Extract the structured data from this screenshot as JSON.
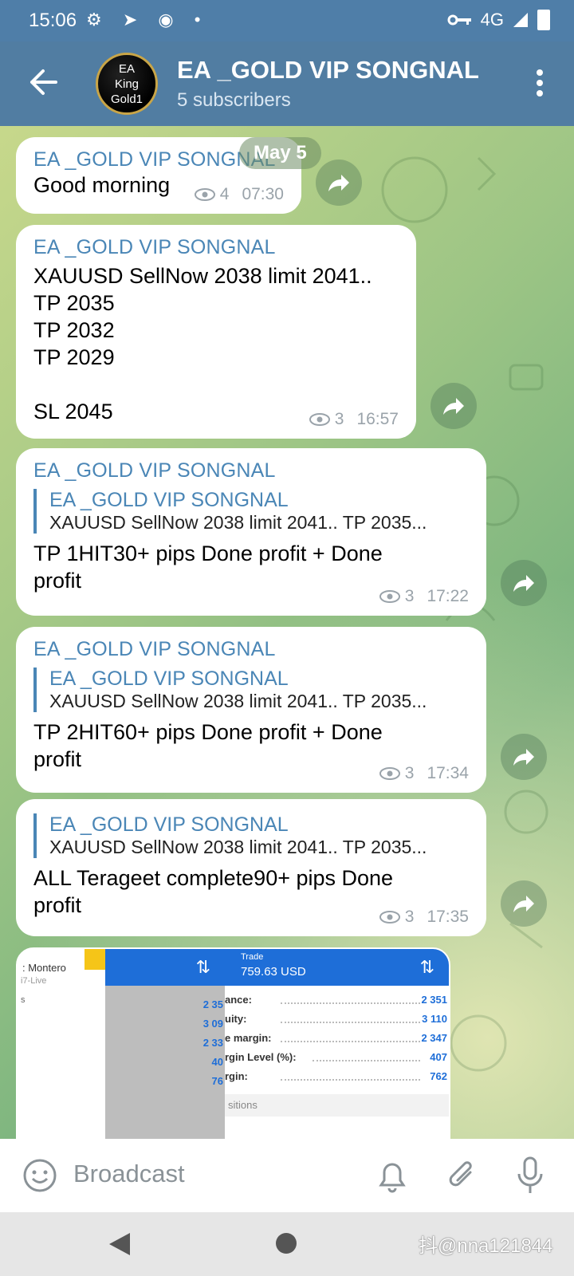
{
  "status": {
    "time": "15:06",
    "left_icons": "⚙ ➤ ◉ •",
    "network": "4G"
  },
  "header": {
    "title": "EA _GOLD VIP SONGNAL",
    "subtitle": "5 subscribers",
    "avatar_text": "EA\nKing\nGold1"
  },
  "date_label": "May 5",
  "messages": [
    {
      "sender": "EA _GOLD VIP SONGNAL",
      "text": "Good morning",
      "views": "4",
      "time": "07:30"
    },
    {
      "sender": "EA _GOLD VIP SONGNAL",
      "text": "XAUUSD SellNow 2038 limit 2041..\nTP 2035\nTP 2032\nTP 2029\n\nSL 2045",
      "views": "3",
      "time": "16:57"
    },
    {
      "sender": "EA _GOLD VIP SONGNAL",
      "reply_name": "EA _GOLD VIP SONGNAL",
      "reply_text": "XAUUSD SellNow 2038 limit 2041.. TP 2035...",
      "text": "TP 1HIT30+ pips  Done profit + Done\nprofit",
      "views": "3",
      "time": "17:22"
    },
    {
      "sender": "EA _GOLD VIP SONGNAL",
      "reply_name": "EA _GOLD VIP SONGNAL",
      "reply_text": "XAUUSD SellNow 2038 limit 2041.. TP 2035...",
      "text": "TP 2HIT60+ pips  Done profit + Done\nprofit",
      "views": "3",
      "time": "17:34"
    },
    {
      "reply_name": "EA _GOLD VIP SONGNAL",
      "reply_text": "XAUUSD SellNow 2038 limit 2041.. TP 2035...",
      "text": "ALL Terageet complete90+ pips  Done\nprofit",
      "views": "3",
      "time": "17:35"
    }
  ],
  "photo": {
    "left_name": ": Montero",
    "left_sub": "i7-Live",
    "left_s": "s",
    "mid_numbers": [
      "2 35",
      "3 09",
      "2 33",
      "40",
      "76"
    ],
    "right_header_label": "Trade",
    "right_amount": "759.63 USD",
    "rows": [
      {
        "label": "ance:",
        "value": "2 351"
      },
      {
        "label": "uity:",
        "value": "3 110"
      },
      {
        "label": "e margin:",
        "value": "2 347"
      },
      {
        "label": "rgin Level (%):",
        "value": "407"
      },
      {
        "label": "rgin:",
        "value": "762"
      }
    ],
    "footer_label": "sitions"
  },
  "input": {
    "placeholder": "Broadcast"
  },
  "watermark": "抖@nna121844"
}
